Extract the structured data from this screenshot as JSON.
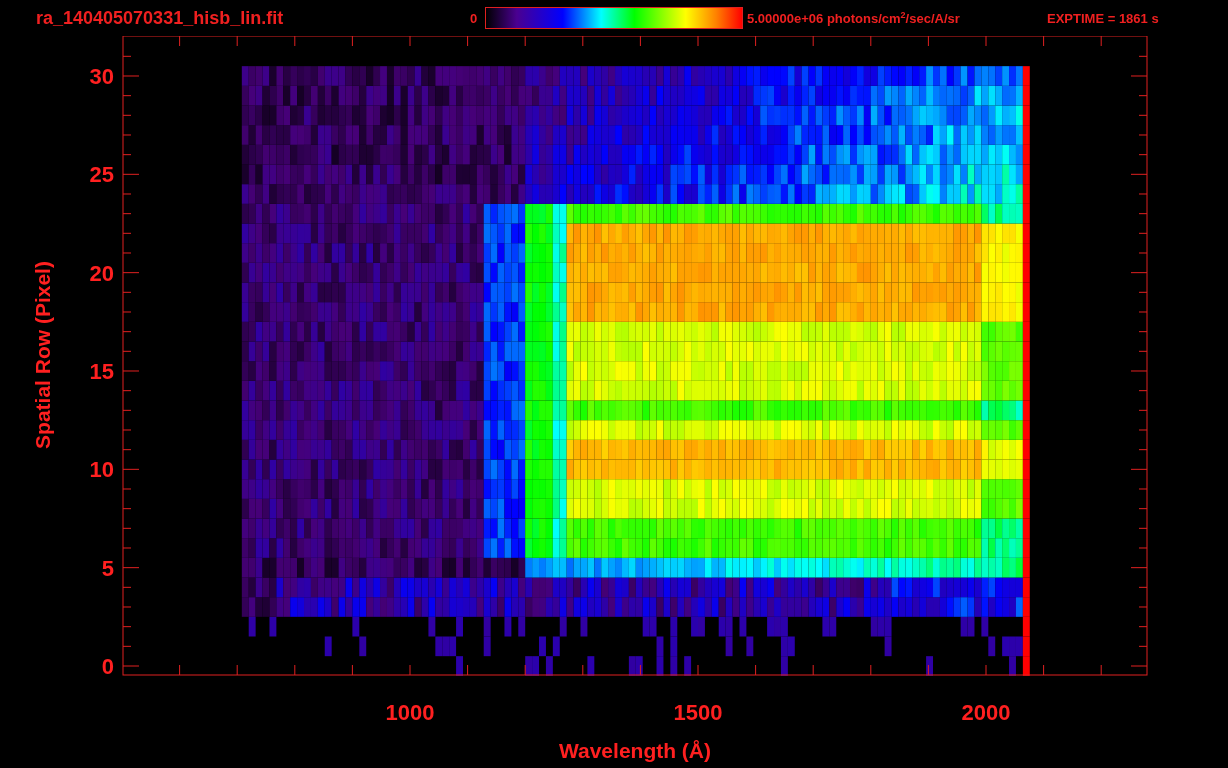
{
  "header": {
    "filename": "ra_140405070331_hisb_lin.fit",
    "colorbar": {
      "min_label": "0",
      "max_label": "5.00000e+06 photons/cm$^{2}$/sec/A/sr"
    },
    "exposure": "EXPTIME = 1861 s"
  },
  "plot": {
    "xlabel": "Wavelength (Å)",
    "ylabel": "Spatial Row (Pixel)",
    "xticks": [
      "1000",
      "1500",
      "2000"
    ],
    "yticks": [
      "30",
      "25",
      "20",
      "15",
      "10",
      "5",
      "0"
    ]
  }
}
